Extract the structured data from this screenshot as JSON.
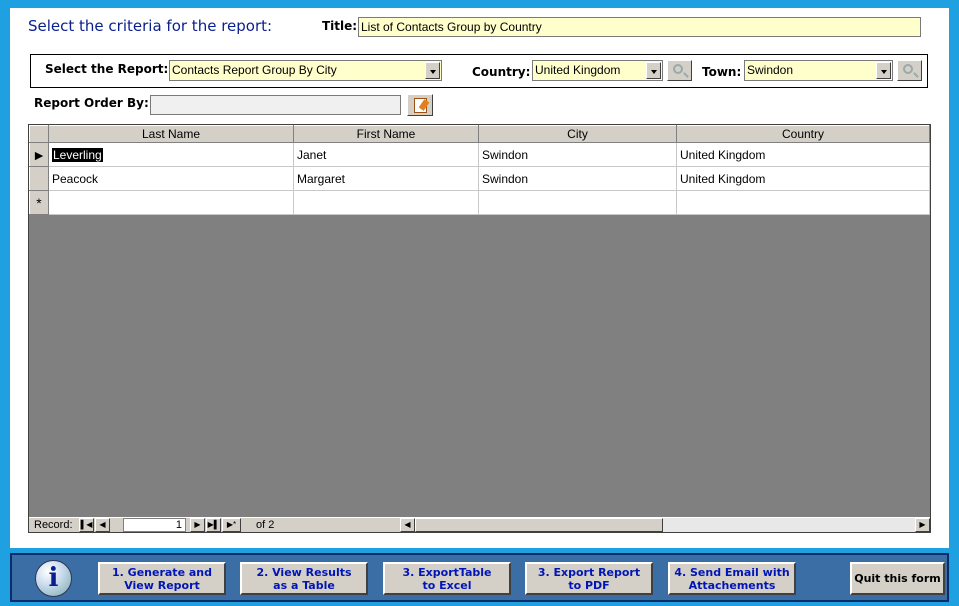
{
  "header": {
    "heading": "Select the criteria for the report:",
    "title_label": "Title:",
    "title_value": "List of Contacts Group by Country"
  },
  "criteria": {
    "report_label": "Select the Report:",
    "report_value": "Contacts Report Group By City",
    "country_label": "Country:",
    "country_value": "United Kingdom",
    "town_label": "Town:",
    "town_value": "Swindon",
    "order_label": "Report Order By:",
    "order_value": ""
  },
  "grid": {
    "columns": [
      "Last Name",
      "First Name",
      "City",
      "Country"
    ],
    "rows": [
      [
        "Leverling",
        "Janet",
        "Swindon",
        "United Kingdom"
      ],
      [
        "Peacock",
        "Margaret",
        "Swindon",
        "United Kingdom"
      ]
    ],
    "new_row_marker": "*"
  },
  "navigator": {
    "record_label": "Record:",
    "current": "1",
    "of_label": "of  2"
  },
  "buttons": {
    "generate": "1. Generate and\nView Report",
    "view_table": "2. View Results\nas a Table",
    "export_excel": "3. ExportTable\nto Excel",
    "export_pdf": "3. Export Report\nto PDF",
    "send_email": "4. Send Email with\nAttachements",
    "quit": "Quit this form"
  },
  "icons": {
    "info": "info-icon",
    "search": "search-icon",
    "report": "report-icon"
  },
  "colors": {
    "background": "#1fa0e0",
    "heading": "#0a1f8f",
    "field": "#ffffcc",
    "bottom_bar": "#3a6ea5",
    "button_text": "#0015b8"
  }
}
